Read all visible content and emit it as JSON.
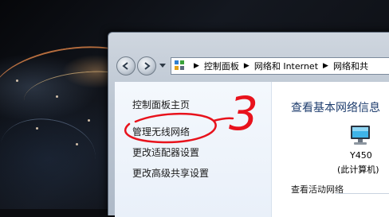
{
  "address_bar": {
    "crumbs": [
      "控制面板",
      "网络和 Internet",
      "网络和共"
    ]
  },
  "sidebar": {
    "items": [
      {
        "label": "控制面板主页"
      },
      {
        "label": "管理无线网络"
      },
      {
        "label": "更改适配器设置"
      },
      {
        "label": "更改高级共享设置"
      }
    ]
  },
  "main": {
    "title": "查看基本网络信息",
    "computer": {
      "name": "Y450",
      "subtitle": "(此计算机)"
    },
    "active_networks_label": "查看活动网络"
  },
  "annotation": {
    "text": "3",
    "color": "#e8121c"
  },
  "icons": {
    "back": "back-arrow-icon",
    "forward": "forward-arrow-icon",
    "location": "control-panel-icon",
    "computer": "computer-monitor-icon"
  }
}
